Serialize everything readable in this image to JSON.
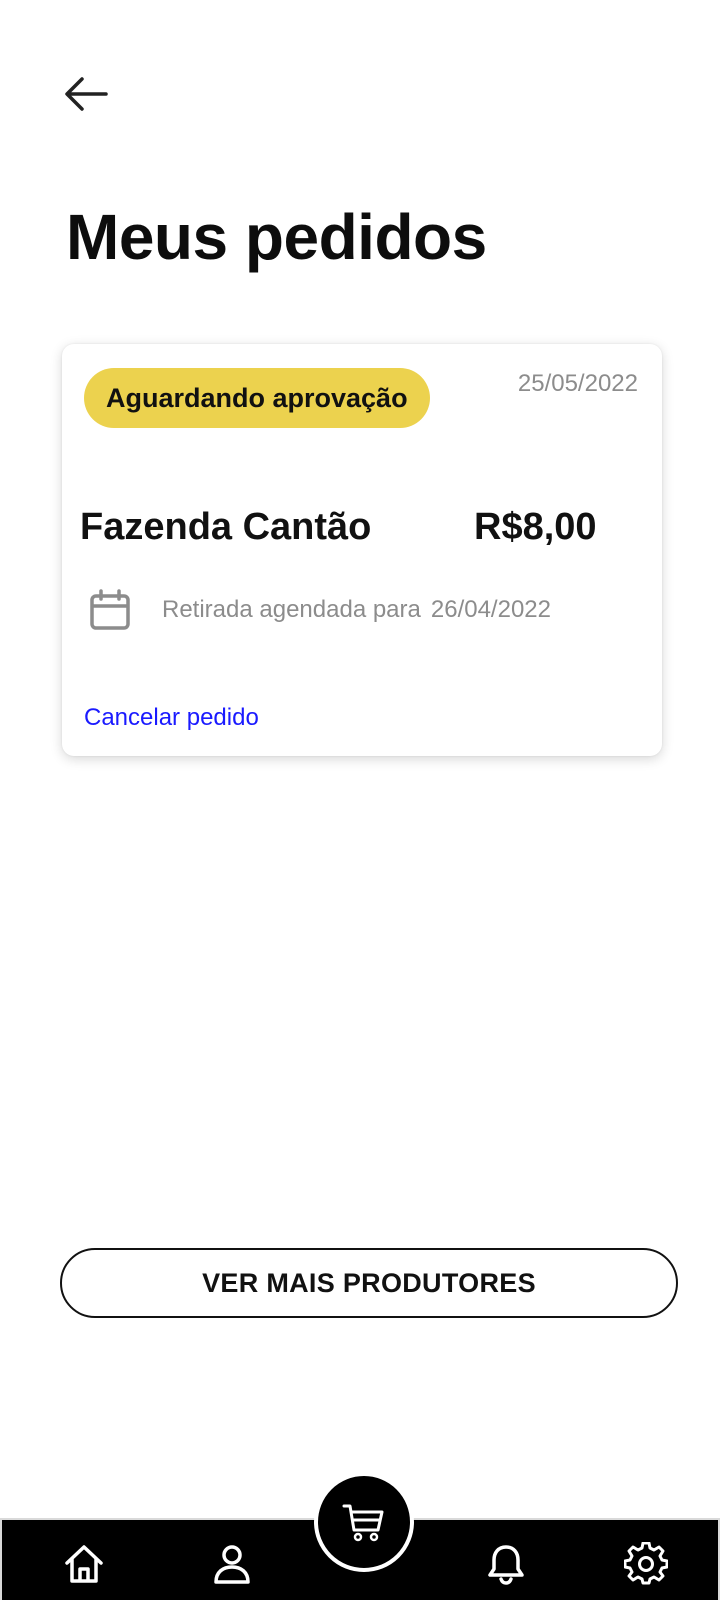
{
  "header": {
    "back_icon": "arrow-left-icon",
    "title": "Meus pedidos"
  },
  "orders": [
    {
      "status": "Aguardando aprovação",
      "status_color": "#ecd24e",
      "date": "25/05/2022",
      "producer": "Fazenda Cantão",
      "price": "R$8,00",
      "pickup_icon": "calendar-icon",
      "pickup_label": "Retirada agendada para",
      "pickup_date": "26/04/2022",
      "cancel_label": "Cancelar pedido"
    }
  ],
  "actions": {
    "more_producers_label": "VER MAIS PRODUTORES"
  },
  "bottom_nav": {
    "items": [
      {
        "icon": "home-icon"
      },
      {
        "icon": "user-icon"
      },
      {
        "icon": "cart-icon"
      },
      {
        "icon": "bell-icon"
      },
      {
        "icon": "gear-icon"
      }
    ]
  },
  "colors": {
    "accent_yellow": "#ecd24e",
    "link_blue": "#1a1aff",
    "muted_text": "#8c8c8c",
    "nav_background": "#000000"
  }
}
